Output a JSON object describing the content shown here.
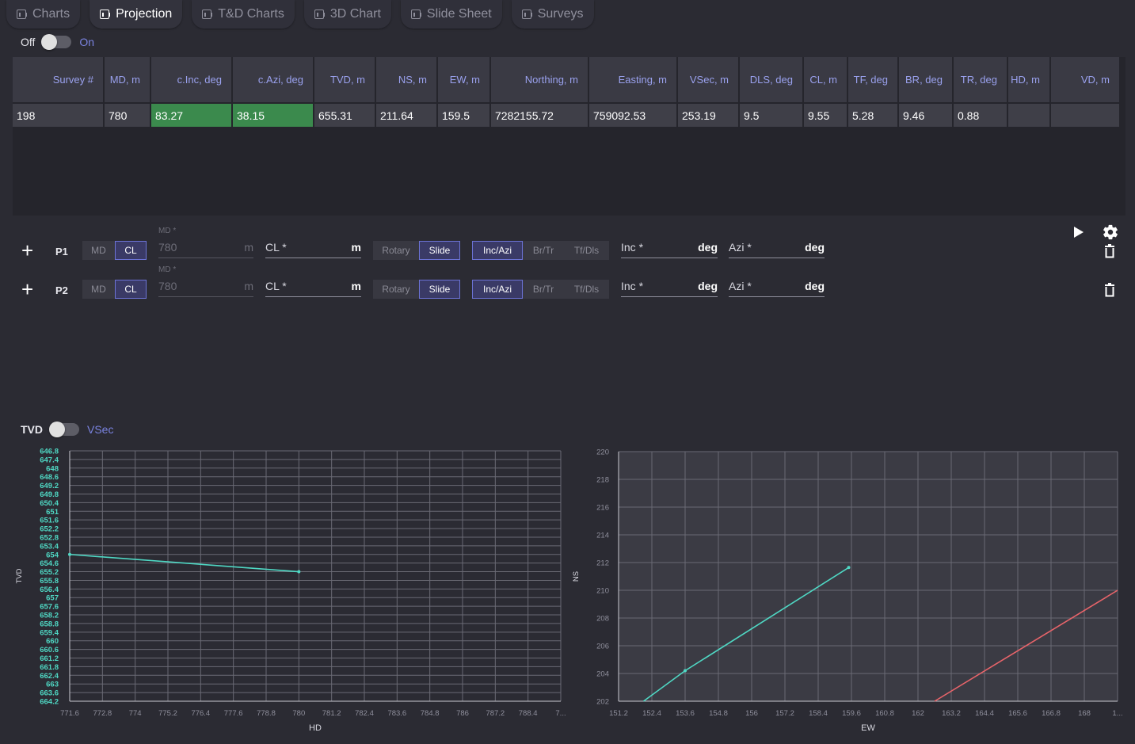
{
  "tabs": [
    {
      "label": "Charts",
      "active": false
    },
    {
      "label": "Projection",
      "active": true
    },
    {
      "label": "T&D Charts",
      "active": false
    },
    {
      "label": "3D Chart",
      "active": false
    },
    {
      "label": "Slide Sheet",
      "active": false
    },
    {
      "label": "Surveys",
      "active": false
    }
  ],
  "mode_toggle": {
    "off_label": "Off",
    "on_label": "On"
  },
  "table": {
    "headers": [
      "Survey #",
      "MD, m",
      "c.Inc, deg",
      "c.Azi, deg",
      "TVD, m",
      "NS, m",
      "EW, m",
      "Northing, m",
      "Easting, m",
      "VSec, m",
      "DLS, deg",
      "CL, m",
      "TF, deg",
      "BR, deg",
      "TR, deg",
      "HD, m",
      "VD, m"
    ],
    "row": [
      "198",
      "780",
      "83.27",
      "38.15",
      "655.31",
      "211.64",
      "159.5",
      "7282155.72",
      "759092.53",
      "253.19",
      "9.5",
      "9.55",
      "5.28",
      "9.46",
      "0.88",
      "",
      ""
    ]
  },
  "plans": [
    {
      "label": "P1",
      "md_label": "MD",
      "cl_label": "CL",
      "md_field_label": "MD *",
      "md_value": "780",
      "md_unit": "m",
      "cl_field_label": "CL *",
      "cl_unit": "m",
      "rotary": "Rotary",
      "slide": "Slide",
      "incazi": "Inc/Azi",
      "brtr": "Br/Tr",
      "tfdls": "Tf/Dls",
      "inc_label": "Inc *",
      "inc_unit": "deg",
      "azi_label": "Azi *",
      "azi_unit": "deg"
    },
    {
      "label": "P2",
      "md_label": "MD",
      "cl_label": "CL",
      "md_field_label": "MD *",
      "md_value": "780",
      "md_unit": "m",
      "cl_field_label": "CL *",
      "cl_unit": "m",
      "rotary": "Rotary",
      "slide": "Slide",
      "incazi": "Inc/Azi",
      "brtr": "Br/Tr",
      "tfdls": "Tf/Dls",
      "inc_label": "Inc *",
      "inc_unit": "deg",
      "azi_label": "Azi *",
      "azi_unit": "deg"
    }
  ],
  "chart_toggle": {
    "left_label": "TVD",
    "right_label": "VSec"
  },
  "colors": {
    "accent": "#7a83e0",
    "series_cyan": "#4fd8c4",
    "series_red": "#e8646a",
    "grid": "#6a6a74"
  },
  "chart_data": [
    {
      "type": "line",
      "xlabel": "HD",
      "ylabel": "TVD",
      "x_ticks": [
        "771.6",
        "772.8",
        "774",
        "775.2",
        "776.4",
        "777.6",
        "778.8",
        "780",
        "781.2",
        "782.4",
        "783.6",
        "784.8",
        "786",
        "787.2",
        "788.4",
        "7..."
      ],
      "y_ticks": [
        "646.8",
        "647.4",
        "648",
        "648.6",
        "649.2",
        "649.8",
        "650.4",
        "651",
        "651.6",
        "652.2",
        "652.8",
        "653.4",
        "654",
        "654.6",
        "655.2",
        "655.8",
        "656.4",
        "657",
        "657.6",
        "658.2",
        "658.8",
        "659.4",
        "660",
        "660.6",
        "661.2",
        "661.8",
        "662.4",
        "663",
        "663.6",
        "664.2"
      ],
      "xlim": [
        771.6,
        789.6
      ],
      "ylim": [
        646.8,
        664.2
      ],
      "y_inverted": true,
      "grid": true,
      "series": [
        {
          "x": [
            771.6,
            780.0
          ],
          "y": [
            654.0,
            655.2
          ],
          "color": "#4fd8c4"
        }
      ]
    },
    {
      "type": "line",
      "xlabel": "EW",
      "ylabel": "NS",
      "x_ticks": [
        "151.2",
        "152.4",
        "153.6",
        "154.8",
        "156",
        "157.2",
        "158.4",
        "159.6",
        "160.8",
        "162",
        "163.2",
        "164.4",
        "165.6",
        "166.8",
        "168",
        "1..."
      ],
      "y_ticks": [
        "220",
        "218",
        "216",
        "214",
        "212",
        "210",
        "208",
        "206",
        "204",
        "202"
      ],
      "xlim": [
        151.2,
        169.2
      ],
      "ylim": [
        202,
        220
      ],
      "grid": true,
      "series": [
        {
          "x": [
            152.1,
            153.6,
            159.5
          ],
          "y": [
            202.0,
            204.2,
            211.64
          ],
          "color": "#4fd8c4"
        },
        {
          "x": [
            162.6,
            169.2
          ],
          "y": [
            202.0,
            210.0
          ],
          "color": "#e8646a"
        }
      ]
    }
  ]
}
